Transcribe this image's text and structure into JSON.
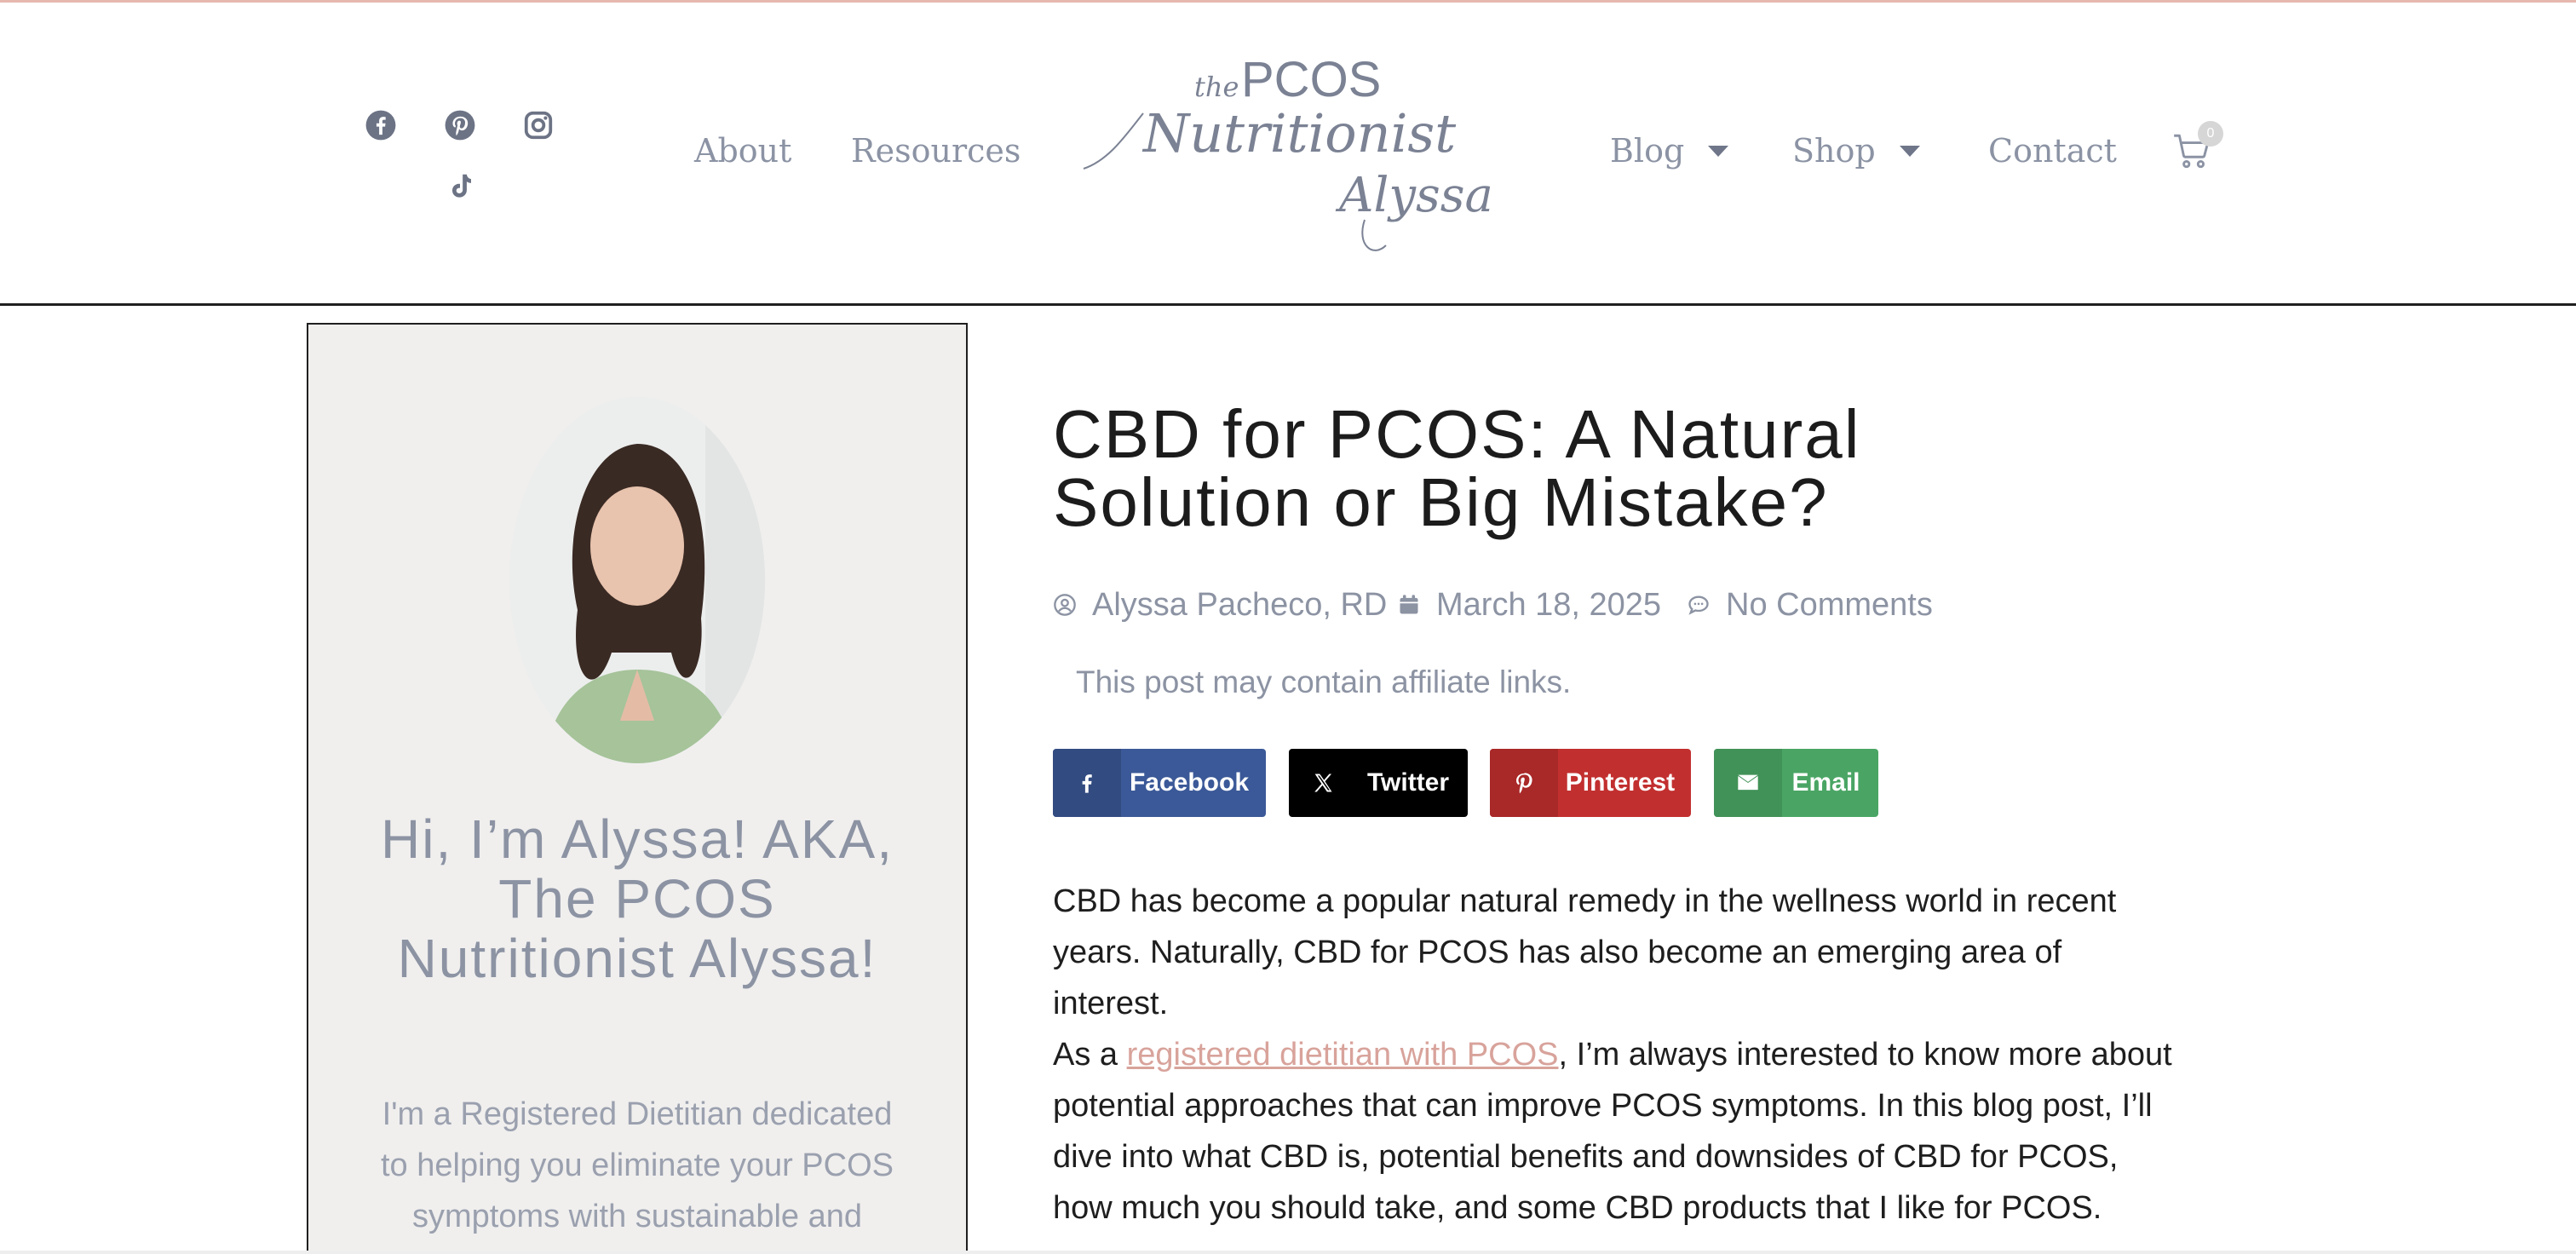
{
  "header": {
    "social": [
      {
        "name": "facebook-icon"
      },
      {
        "name": "pinterest-icon"
      },
      {
        "name": "instagram-icon"
      },
      {
        "name": "tiktok-icon"
      }
    ],
    "nav_left": [
      {
        "label": "About"
      },
      {
        "label": "Resources"
      }
    ],
    "nav_right": [
      {
        "label": "Blog",
        "has_dropdown": true
      },
      {
        "label": "Shop",
        "has_dropdown": true
      },
      {
        "label": "Contact",
        "has_dropdown": false
      }
    ],
    "logo": {
      "line1": "the",
      "line2": "PCOS",
      "line3": "Nutritionist",
      "line4": "Alyssa"
    },
    "cart": {
      "count": "0"
    }
  },
  "sidebar": {
    "title": "Hi, I’m Alyssa! AKA, The PCOS Nutritionist Alyssa!",
    "text": "I'm a Registered Dietitian dedicated to helping you eliminate your PCOS symptoms with sustainable and"
  },
  "post": {
    "title": "CBD for PCOS: A Natural Solution or Big Mistake?",
    "author": "Alyssa Pacheco, RD",
    "date": "March 18, 2025",
    "comments": "No Comments",
    "affiliate_note": "This post may contain affiliate links.",
    "share_buttons": [
      {
        "label": "Facebook",
        "color": "#3b5998",
        "icon": "facebook-icon"
      },
      {
        "label": "Twitter",
        "color": "#000000",
        "icon": "x-icon"
      },
      {
        "label": "Pinterest",
        "color": "#c22f2f",
        "icon": "pinterest-icon"
      },
      {
        "label": "Email",
        "color": "#4aa564",
        "icon": "email-icon"
      }
    ],
    "paragraph1": "CBD has become a popular natural remedy in the wellness world in recent years. Naturally, CBD for PCOS has also become an emerging area of interest.",
    "paragraph2": {
      "prefix": "As a ",
      "link": "registered dietitian with PCOS",
      "suffix": ", I’m always interested to know more about potential approaches that can improve PCOS symptoms. In this blog post, I’ll dive into what CBD is, potential benefits and downsides of CBD for PCOS, how much you should take, and some CBD products that I like for PCOS."
    }
  },
  "colors": {
    "accent_top_line": "#e7b8ae",
    "nav_text": "#8b93a4",
    "link": "#d8a39b",
    "sidebar_bg": "#f0efee"
  }
}
